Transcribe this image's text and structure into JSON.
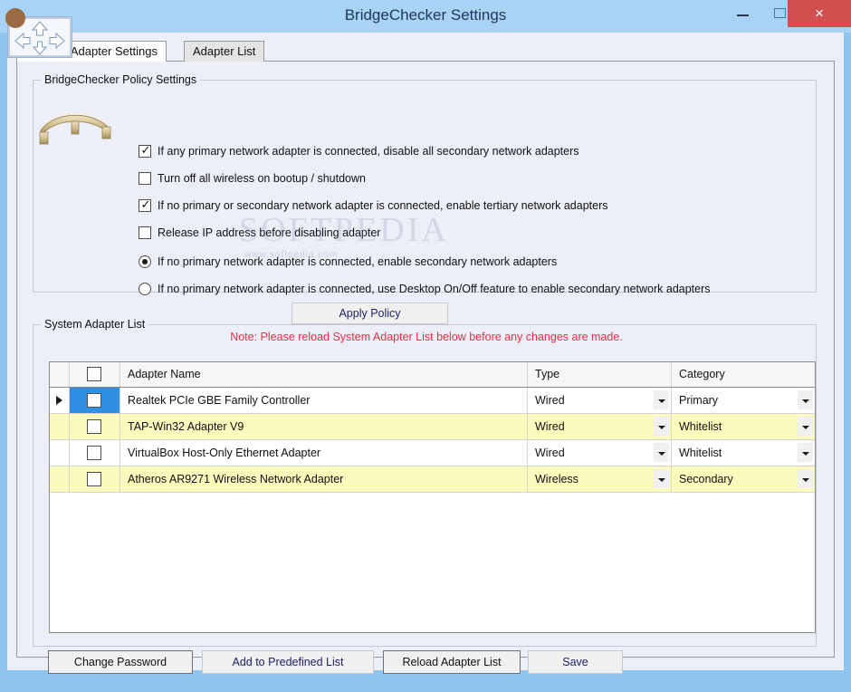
{
  "window": {
    "title": "BridgeChecker Settings",
    "minimize_label": "–",
    "maximize_label": "",
    "close_label": "×",
    "frame_color": "#8ec5f0",
    "titlebar_color": "#a8d3f5",
    "close_color": "#d0504f",
    "app_icon": "bridge-arrows-icon"
  },
  "tabs": [
    {
      "label": "Policy & Adapter Settings",
      "active": true
    },
    {
      "label": "Adapter List",
      "active": false
    }
  ],
  "policy_group": {
    "title": "BridgeChecker Policy Settings",
    "picture": "bridge-image",
    "checkboxes": [
      {
        "label": "If any primary network adapter is connected, disable all secondary network adapters",
        "checked": true
      },
      {
        "label": "Turn off all wireless on bootup / shutdown",
        "checked": false
      },
      {
        "label": "If no primary or secondary network adapter is connected, enable tertiary network adapters",
        "checked": true
      },
      {
        "label": "Release IP address before disabling adapter",
        "checked": false
      }
    ],
    "radios": [
      {
        "label": "If no primary network adapter is connected, enable secondary network adapters",
        "selected": true
      },
      {
        "label": "If no primary network adapter is connected, use Desktop On/Off feature to enable secondary network adapters",
        "selected": false
      }
    ],
    "apply_button": "Apply Policy"
  },
  "note": {
    "text": "Note: Please reload System Adapter List below before any changes are made.",
    "color": "#ef2d41"
  },
  "list_group": {
    "title": "System Adapter List",
    "columns": [
      "",
      "",
      "Adapter Name",
      "Type",
      "Category"
    ],
    "header_checkbox_checked": false,
    "rows": [
      {
        "current": true,
        "checked": false,
        "name": "Realtek PCIe GBE Family Controller",
        "type": "Wired",
        "category": "Primary",
        "highlight": "white",
        "check_cell_selected": true
      },
      {
        "current": false,
        "checked": false,
        "name": "TAP-Win32 Adapter V9",
        "type": "Wired",
        "category": "Whitelist",
        "highlight": "yellow",
        "check_cell_selected": false
      },
      {
        "current": false,
        "checked": false,
        "name": "VirtualBox Host-Only Ethernet Adapter",
        "type": "Wired",
        "category": "Whitelist",
        "highlight": "white",
        "check_cell_selected": false
      },
      {
        "current": false,
        "checked": false,
        "name": "Atheros AR9271 Wireless Network Adapter",
        "type": "Wireless",
        "category": "Secondary",
        "highlight": "yellow",
        "check_cell_selected": false
      }
    ]
  },
  "bottom_buttons": [
    {
      "label": "Change Password",
      "emphasis": "strong"
    },
    {
      "label": "Add to Predefined List",
      "emphasis": "light"
    },
    {
      "label": "Reload Adapter List",
      "emphasis": "strong"
    },
    {
      "label": "Save",
      "emphasis": "light"
    }
  ],
  "watermark": {
    "main": "SOFTPEDIA",
    "sub": "www.softpedia.com"
  }
}
